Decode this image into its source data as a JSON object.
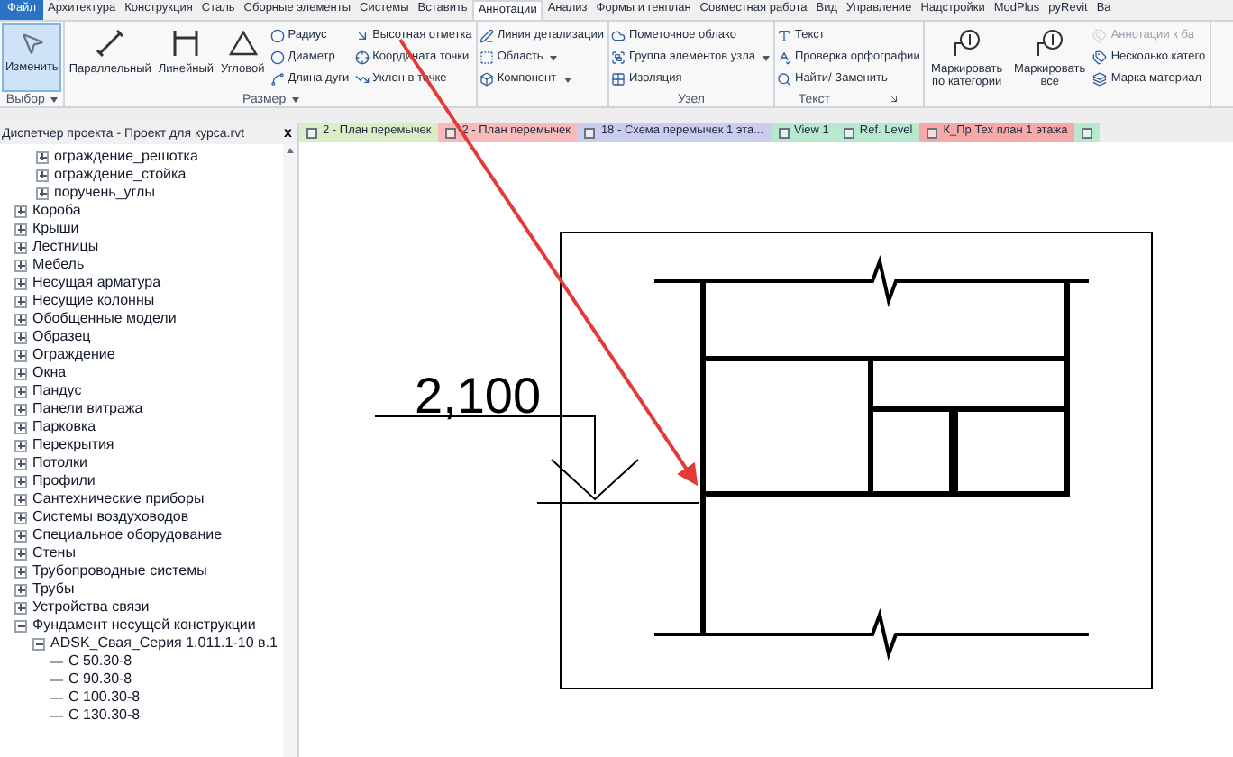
{
  "menu_tabs": [
    {
      "label": "Файл",
      "kind": "file"
    },
    {
      "label": "Архитектура",
      "kind": "tab",
      "selected": false
    },
    {
      "label": "Конструкция",
      "kind": "tab",
      "selected": false
    },
    {
      "label": "Сталь",
      "kind": "tab",
      "selected": false
    },
    {
      "label": "Сборные элементы",
      "kind": "tab",
      "selected": false
    },
    {
      "label": "Системы",
      "kind": "tab",
      "selected": false
    },
    {
      "label": "Вставить",
      "kind": "tab",
      "selected": false
    },
    {
      "label": "Аннотации",
      "kind": "tab",
      "selected": true
    },
    {
      "label": "Анализ",
      "kind": "tab",
      "selected": false
    },
    {
      "label": "Формы и генплан",
      "kind": "tab",
      "selected": false
    },
    {
      "label": "Совместная работа",
      "kind": "tab",
      "selected": false
    },
    {
      "label": "Вид",
      "kind": "tab",
      "selected": false
    },
    {
      "label": "Управление",
      "kind": "tab",
      "selected": false
    },
    {
      "label": "Надстройки",
      "kind": "tab",
      "selected": false
    },
    {
      "label": "ModPlus",
      "kind": "tab",
      "selected": false
    },
    {
      "label": "pyRevit",
      "kind": "tab",
      "selected": false
    },
    {
      "label": "Ва",
      "kind": "tab",
      "selected": false
    }
  ],
  "ribbon_panels": [
    {
      "label": "Выбор",
      "menu_caret": true,
      "dialog_launcher": false,
      "large": [
        {
          "label": "Изменить",
          "selected": true
        }
      ]
    },
    {
      "label": "Размер",
      "menu_caret": true,
      "dialog_launcher": false,
      "large": [
        {
          "label": "Параллельный",
          "selected": false
        },
        {
          "label": "Линейный",
          "selected": false
        },
        {
          "label": "Угловой",
          "selected": false
        }
      ],
      "columns": [
        [
          {
            "label": "Радиус",
            "dropdown": false,
            "disabled": false
          },
          {
            "label": "Диаметр",
            "dropdown": false,
            "disabled": false
          },
          {
            "label": "Длина дуги",
            "dropdown": false,
            "disabled": false
          }
        ],
        [
          {
            "label": "Высотная отметка",
            "dropdown": false,
            "disabled": false
          },
          {
            "label": "Координата точки",
            "dropdown": false,
            "disabled": false
          },
          {
            "label": "Уклон  в точке",
            "dropdown": false,
            "disabled": false
          }
        ]
      ]
    },
    {
      "menu_caret": false,
      "dialog_launcher": false,
      "columns": [
        [
          {
            "label": "Линия детализации",
            "dropdown": false,
            "disabled": false
          },
          {
            "label": "Область",
            "dropdown": true,
            "disabled": false
          },
          {
            "label": "Компонент",
            "dropdown": true,
            "disabled": false
          }
        ]
      ]
    },
    {
      "label": "Узел",
      "menu_caret": false,
      "dialog_launcher": false,
      "columns": [
        [
          {
            "label": "Пометочное облако",
            "dropdown": false,
            "disabled": false
          },
          {
            "label": "Группа элементов узла",
            "dropdown": true,
            "disabled": false
          },
          {
            "label": "Изоляция",
            "dropdown": false,
            "disabled": false
          }
        ]
      ]
    },
    {
      "label": "Текст",
      "menu_caret": false,
      "dialog_launcher": true,
      "columns": [
        [
          {
            "label": "Текст",
            "dropdown": false,
            "disabled": false
          },
          {
            "label": "Проверка  орфографии",
            "dropdown": false,
            "disabled": false
          },
          {
            "label": "Найти/ Заменить",
            "dropdown": false,
            "disabled": false
          }
        ]
      ]
    },
    {
      "menu_caret": false,
      "dialog_launcher": false,
      "large": [
        {
          "label": "Маркировать по категории",
          "selected": false
        },
        {
          "label": "Маркировать все",
          "selected": false
        }
      ],
      "columns": [
        [
          {
            "label": "Аннотации к ба",
            "dropdown": false,
            "disabled": true
          },
          {
            "label": "Несколько катего",
            "dropdown": false,
            "disabled": false
          },
          {
            "label": "Марка материал",
            "dropdown": false,
            "disabled": false
          }
        ]
      ]
    }
  ],
  "project_browser": {
    "title": "Диспетчер проекта - Проект для курса.rvt",
    "close": "x",
    "continued_children": [
      {
        "label": "ограждение_решотка",
        "expanded": false
      },
      {
        "label": "ограждение_стойка",
        "expanded": false
      },
      {
        "label": "поручень_углы",
        "expanded": false
      }
    ],
    "items": [
      {
        "label": "Короба",
        "expanded": false
      },
      {
        "label": "Крыши",
        "expanded": false
      },
      {
        "label": "Лестницы",
        "expanded": false
      },
      {
        "label": "Мебель",
        "expanded": false
      },
      {
        "label": "Несущая арматура",
        "expanded": false
      },
      {
        "label": "Несущие колонны",
        "expanded": false
      },
      {
        "label": "Обобщенные модели",
        "expanded": false
      },
      {
        "label": "Образец",
        "expanded": false
      },
      {
        "label": "Ограждение",
        "expanded": false
      },
      {
        "label": "Окна",
        "expanded": false
      },
      {
        "label": "Пандус",
        "expanded": false
      },
      {
        "label": "Панели витража",
        "expanded": false
      },
      {
        "label": "Парковка",
        "expanded": false
      },
      {
        "label": "Перекрытия",
        "expanded": false
      },
      {
        "label": "Потолки",
        "expanded": false
      },
      {
        "label": "Профили",
        "expanded": false
      },
      {
        "label": "Сантехнические приборы",
        "expanded": false
      },
      {
        "label": "Системы воздуховодов",
        "expanded": false
      },
      {
        "label": "Специальное оборудование",
        "expanded": false
      },
      {
        "label": "Стены",
        "expanded": false
      },
      {
        "label": "Трубопроводные системы",
        "expanded": false
      },
      {
        "label": "Трубы",
        "expanded": false
      },
      {
        "label": "Устройства связи",
        "expanded": false
      },
      {
        "label": "Фундамент несущей конструкции",
        "expanded": true,
        "children": [
          {
            "label": "ADSK_Свая_Серия 1.011.1-10 в.1",
            "expanded": true,
            "children": [
              {
                "label": "С 50.30-8"
              },
              {
                "label": "С 90.30-8"
              },
              {
                "label": "С 100.30-8"
              },
              {
                "label": "С 130.30-8"
              }
            ]
          }
        ]
      }
    ]
  },
  "view_tabs": [
    {
      "label": "2 - План перемычек",
      "color": "#d9eec7"
    },
    {
      "label": "2 - План перемычек",
      "color": "#f8baba"
    },
    {
      "label": "18 - Схема перемычек 1 эта...",
      "color": "#cbcdee"
    },
    {
      "label": "View 1",
      "color": "#b8e8cf"
    },
    {
      "label": "Ref. Level",
      "color": "#b8e8cf"
    },
    {
      "label": "К_Пр Тех план 1 этажа",
      "color": "#f6a9a9"
    },
    {
      "color": "#b8e8cf"
    }
  ],
  "drawing": {
    "dimension_text": "2,100"
  }
}
